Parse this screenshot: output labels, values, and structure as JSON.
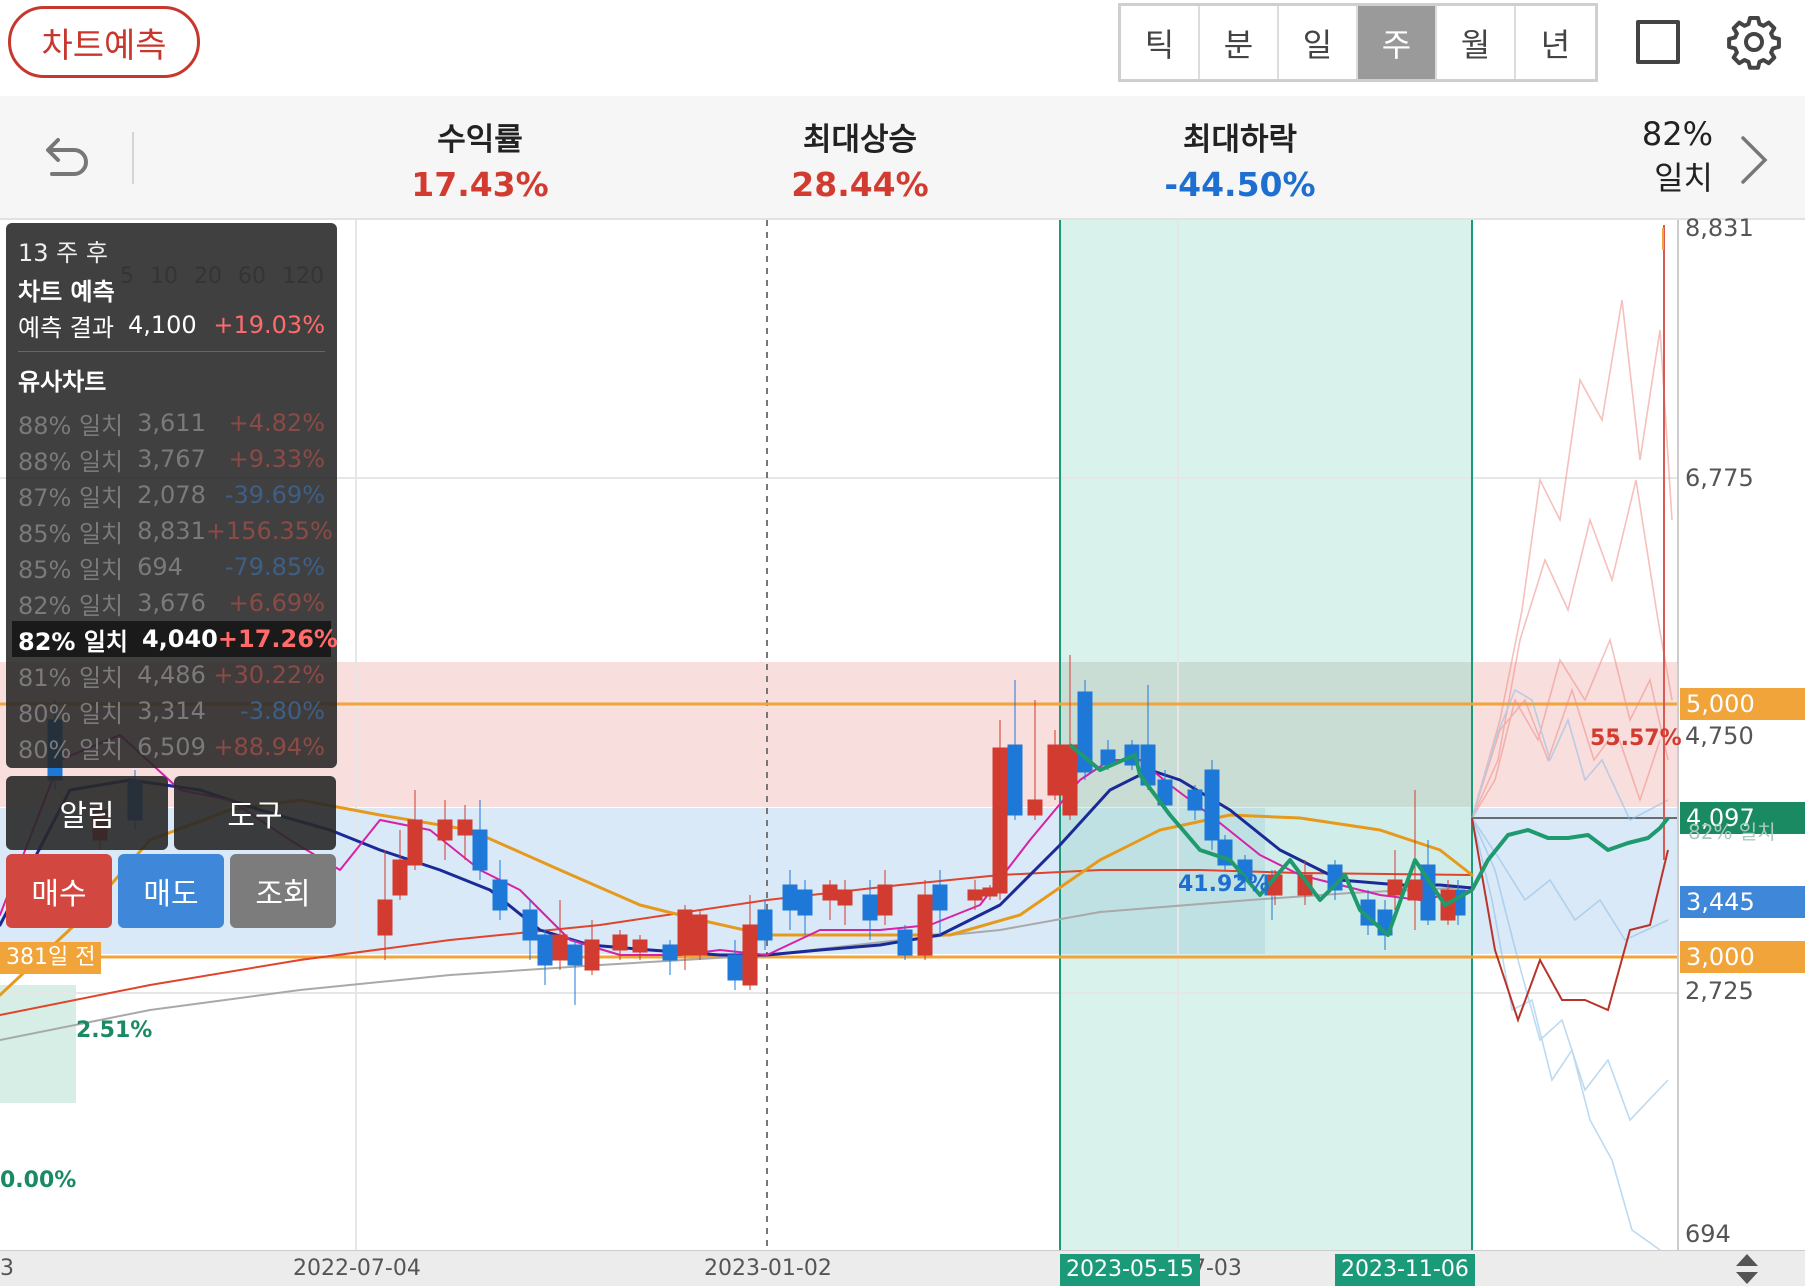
{
  "header": {
    "predict_button": "차트예측",
    "period_tabs": [
      {
        "label": "틱",
        "active": false
      },
      {
        "label": "분",
        "active": false
      },
      {
        "label": "일",
        "active": false
      },
      {
        "label": "주",
        "active": true
      },
      {
        "label": "월",
        "active": false
      },
      {
        "label": "년",
        "active": false
      }
    ],
    "icons": [
      "fullscreen-square-icon",
      "settings-gear-icon"
    ]
  },
  "stats": {
    "return_label": "수익률",
    "return_value": "17.43%",
    "max_up_label": "최대상승",
    "max_up_value": "28.44%",
    "max_down_label": "최대하락",
    "max_down_value": "-44.50%",
    "match_pct": "82%",
    "match_label": "일치"
  },
  "panel": {
    "weeks_after": "13 주 후",
    "title": "차트 예측",
    "result_label": "예측 결과",
    "result_price": "4,100",
    "result_change": "+19.03%",
    "similar_title": "유사차트",
    "similar": [
      {
        "match": "88% 일치",
        "price": "3,611",
        "change": "+4.82%",
        "highlight": false
      },
      {
        "match": "88% 일치",
        "price": "3,767",
        "change": "+9.33%",
        "highlight": false
      },
      {
        "match": "87% 일치",
        "price": "2,078",
        "change": "-39.69%",
        "highlight": false
      },
      {
        "match": "85% 일치",
        "price": "8,831",
        "change": "+156.35%",
        "highlight": false
      },
      {
        "match": "85% 일치",
        "price": "694",
        "change": "-79.85%",
        "highlight": false
      },
      {
        "match": "82% 일치",
        "price": "3,676",
        "change": "+6.69%",
        "highlight": false
      },
      {
        "match": "82% 일치",
        "price": "4,040",
        "change": "+17.26%",
        "highlight": true
      },
      {
        "match": "81% 일치",
        "price": "4,486",
        "change": "+30.22%",
        "highlight": false
      },
      {
        "match": "80% 일치",
        "price": "3,314",
        "change": "-3.80%",
        "highlight": false
      },
      {
        "match": "80% 일치",
        "price": "6,509",
        "change": "+88.94%",
        "highlight": false
      }
    ]
  },
  "actions": {
    "alert": "알림",
    "tools": "도구",
    "buy": "매수",
    "sell": "매도",
    "view": "조회"
  },
  "chart": {
    "legend_ma": [
      "5",
      "10",
      "20",
      "60",
      "120"
    ],
    "y_ticks": [
      "8,831",
      "6,775",
      "4,750",
      "2,725",
      "694"
    ],
    "price_tags": [
      {
        "label": "5,000",
        "color": "#f0a43a"
      },
      {
        "label": "4,097",
        "color": "#1a8a62"
      },
      {
        "label": "3,445",
        "color": "#3f87d8"
      },
      {
        "label": "3,000",
        "color": "#f0a43a"
      }
    ],
    "x_ticks": [
      "2022-07-04",
      "2023-01-02",
      "7-03"
    ],
    "x_left_fragment": "3",
    "highlight_dates": [
      "2023-05-15",
      "2023-11-06"
    ],
    "annotations": {
      "days_ago": "381일 전",
      "pct_left_low": "2.51%",
      "pct_left_zero": "0.00%",
      "pct_blue": "41.92%",
      "pct_red": "55.57%",
      "match_hidden": "82% 일치"
    },
    "colors": {
      "up": "#d23b2f",
      "down": "#1e78d8",
      "ma5": "#d621a8",
      "ma10": "#1a2a96",
      "ma20": "#e69a1c",
      "ma60": "#e0442c",
      "ma120": "#a9a9a9",
      "pred": "#1f9a6e"
    }
  }
}
